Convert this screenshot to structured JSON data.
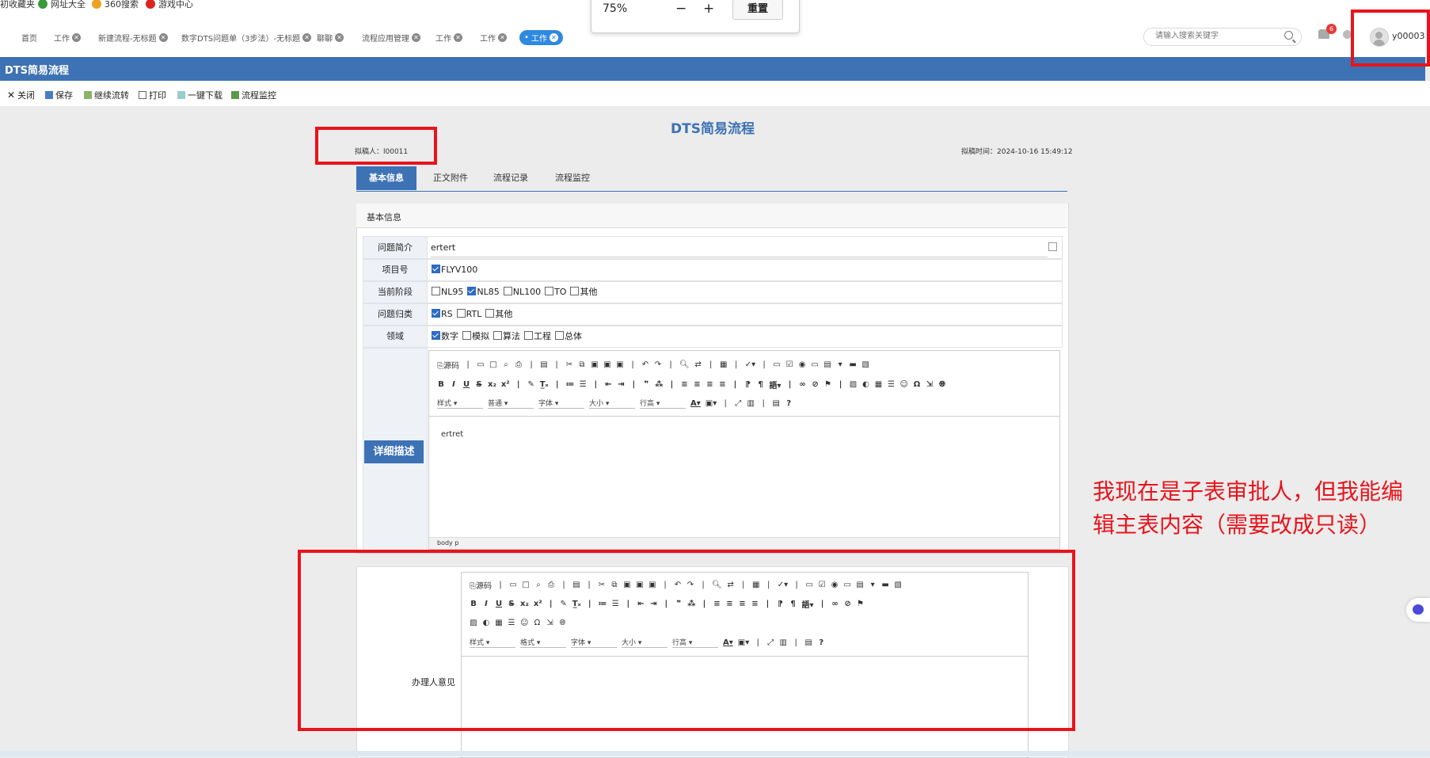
{
  "bookmarks": [
    "初收藏夹",
    "网址大全",
    "360搜索",
    "游戏中心"
  ],
  "zoom": {
    "percent": "75%",
    "minus": "−",
    "plus": "+",
    "reset": "重置"
  },
  "tabs": [
    {
      "label": "首页",
      "closable": false
    },
    {
      "label": "工作",
      "closable": true
    },
    {
      "label": "新建流程-无标题",
      "closable": true
    },
    {
      "label": "数字DTS问题单（3步法）-无标题",
      "closable": true
    },
    {
      "label": "聊聊",
      "closable": true
    },
    {
      "label": "流程应用管理",
      "closable": true
    },
    {
      "label": "工作",
      "closable": true
    },
    {
      "label": "工作",
      "closable": true
    },
    {
      "label": "工作",
      "closable": true,
      "active": true
    }
  ],
  "search": {
    "placeholder": "请输入搜索关键字"
  },
  "notify_count": "6",
  "user": "y00003",
  "page_header": "DTS简易流程",
  "toolbar": [
    "关闭",
    "保存",
    "继续流转",
    "打印",
    "一键下载",
    "流程监控"
  ],
  "form": {
    "title": "DTS简易流程",
    "drafter": "拟稿人：l00011",
    "draft_time": "拟稿时间：2024-10-16 15:49:12",
    "tabs": [
      "基本信息",
      "正文附件",
      "流程记录",
      "流程监控"
    ],
    "panel_title": "基本信息",
    "fields": {
      "summary_label": "问题简介",
      "summary_value": "ertert",
      "project_label": "项目号",
      "project_options": [
        {
          "label": "FLYV100",
          "checked": true
        }
      ],
      "stage_label": "当前阶段",
      "stage_options": [
        {
          "label": "NL95",
          "checked": false
        },
        {
          "label": "NL85",
          "checked": true
        },
        {
          "label": "NL100",
          "checked": false
        },
        {
          "label": "TO",
          "checked": false
        },
        {
          "label": "其他",
          "checked": false
        }
      ],
      "category_label": "问题归类",
      "category_options": [
        {
          "label": "RS",
          "checked": true
        },
        {
          "label": "RTL",
          "checked": false
        },
        {
          "label": "其他",
          "checked": false
        }
      ],
      "domain_label": "领域",
      "domain_options": [
        {
          "label": "数字",
          "checked": true
        },
        {
          "label": "模拟",
          "checked": false
        },
        {
          "label": "算法",
          "checked": false
        },
        {
          "label": "工程",
          "checked": false
        },
        {
          "label": "总体",
          "checked": false
        }
      ],
      "detail_label": "详细描述",
      "detail_text": "ertret",
      "statusbar": "body  p"
    },
    "editor": {
      "source_label": "源码",
      "style_dd": "样式",
      "format_dd": "普通",
      "font_dd": "字体",
      "size_dd": "大小",
      "lineheight_dd": "行高",
      "format_dd2": "格式"
    },
    "opinion_label": "办理人意见"
  },
  "annotation": "我现在是子表审批人，但我能编辑主表内容（需要改成只读）",
  "colors": {
    "brand": "#3d72b4",
    "annotation": "#e8141c",
    "active_tab": "#2e89e0"
  }
}
